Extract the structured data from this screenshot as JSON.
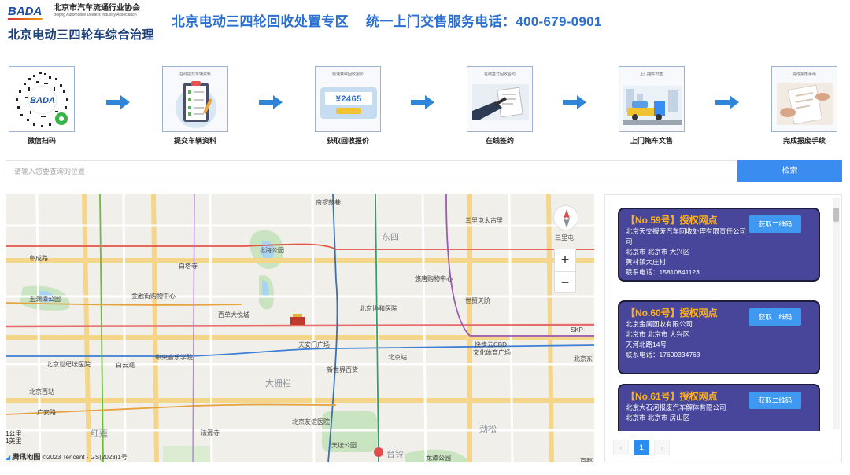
{
  "header": {
    "logo_mark": "BADA",
    "association_cn": "北京市汽车流通行业协会",
    "association_en": "Beijing Automobile Dealers Industry Association",
    "logo_subtitle": "北京电动三四轮车综合治理",
    "headline_left": "北京电动三四轮回收处置专区",
    "headline_right": "统一上门交售服务电话：400-679-0901"
  },
  "steps": [
    {
      "caption": "微信扫码",
      "icon": "qr-code-icon",
      "mini": ""
    },
    {
      "caption": "提交车辆资料",
      "icon": "clipboard-icon",
      "mini": "在线提交车辆资料"
    },
    {
      "caption": "获取回收报价",
      "icon": "price-card-icon",
      "mini": "快速获取回收报价",
      "price": "¥2465"
    },
    {
      "caption": "在线签约",
      "icon": "contract-icon",
      "mini": "在线签订回收合约"
    },
    {
      "caption": "上门拖车文售",
      "icon": "tow-truck-icon",
      "mini": "上门拖车交售"
    },
    {
      "caption": "完成报废手续",
      "icon": "document-icon",
      "mini": "完成报废手续"
    }
  ],
  "search": {
    "placeholder": "请输入您要查询的位置",
    "button_label": "检索"
  },
  "map": {
    "labels": [
      "南锣鼓巷",
      "三里屯太古里",
      "东四",
      "北海公园",
      "阜成路",
      "白塔寺",
      "悠唐购物中心",
      "金融街购物中心",
      "玉渊潭公园",
      "世贸天阶",
      "西单大悦城",
      "北京协和医院",
      "SKP-",
      "天安门广场",
      "北京站",
      "快步云CBD",
      "文化体育广场",
      "中央音乐学院",
      "北京世纪坛医院",
      "白云观",
      "新世界百货",
      "大栅栏",
      "北京西站",
      "广安路",
      "北京友谊医院",
      "劲松",
      "红莲",
      "法源寺",
      "天坛公园",
      "台铃",
      "龙潭公园",
      "三里屯",
      "北京东",
      "京都"
    ],
    "zoom_in": "+",
    "zoom_out": "−",
    "scale_metric": "1公里",
    "scale_imperial": "1英里",
    "attribution_brand": "腾讯地图",
    "attribution_text": "©2023 Tencent - GS(2023)1号"
  },
  "list": {
    "get_qr_label": "获取二维码",
    "cards": [
      {
        "title": "【No.59号】授权网点",
        "company": "北京天交报废汽车回收处理有限责任公司",
        "company_2": "司",
        "region": "北京市 北京市 大兴区",
        "address": "黄村镇大庄村",
        "phone": "联系电话：15810841123"
      },
      {
        "title": "【No.60号】授权网点",
        "company": "北京金属回收有限公司",
        "company_2": "",
        "region": "北京市 北京市 大兴区",
        "address": "天河北路14号",
        "phone": "联系电话：17600334763"
      },
      {
        "title": "【No.61号】授权网点",
        "company": "北京大石河报废汽车解体有限公司",
        "company_2": "",
        "region": "北京市 北京市 房山区",
        "address": "",
        "phone": ""
      }
    ]
  },
  "pager": {
    "prev": "‹",
    "current": "1",
    "next": "›"
  },
  "colors": {
    "headline": "#2a6fd2",
    "card_bg": "#47469a",
    "card_title": "#ffb21c",
    "button_blue": "#3b8cf0",
    "arrow_blue": "#2f86d9"
  }
}
